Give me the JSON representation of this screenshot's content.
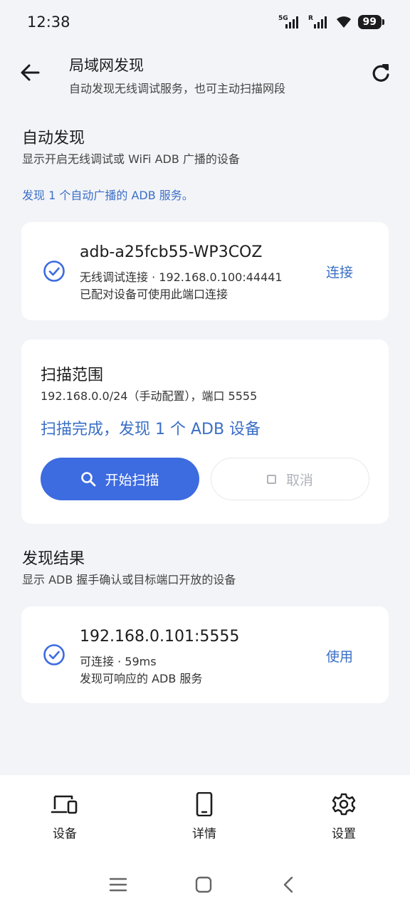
{
  "status": {
    "time": "12:38",
    "network": "5G",
    "battery": "99"
  },
  "header": {
    "title": "局域网发现",
    "subtitle": "自动发现无线调试服务，也可主动扫描网段"
  },
  "auto_discovery": {
    "title": "自动发现",
    "subtitle": "显示开启无线调试或 WiFi ADB 广播的设备",
    "info": "发现 1 个自动广播的 ADB 服务。",
    "item": {
      "name": "adb-a25fcb55-WP3COZ",
      "detail": "无线调试连接 · 192.168.0.100:44441",
      "note": "已配对设备可使用此端口连接",
      "action": "连接"
    }
  },
  "scan": {
    "title": "扫描范围",
    "range": "192.168.0.0/24（手动配置），端口 5555",
    "status": "扫描完成，发现 1 个 ADB 设备",
    "start_label": "开始扫描",
    "cancel_label": "取消"
  },
  "results": {
    "title": "发现结果",
    "subtitle": "显示 ADB 握手确认或目标端口开放的设备",
    "item": {
      "name": "192.168.0.101:5555",
      "detail": "可连接 · 59ms",
      "note": "发现可响应的 ADB 服务",
      "action": "使用"
    }
  },
  "nav": {
    "devices": "设备",
    "details": "详情",
    "settings": "设置"
  },
  "colors": {
    "accent": "#3d6be0",
    "link": "#3a6fc7",
    "background": "#f3f4f8"
  }
}
